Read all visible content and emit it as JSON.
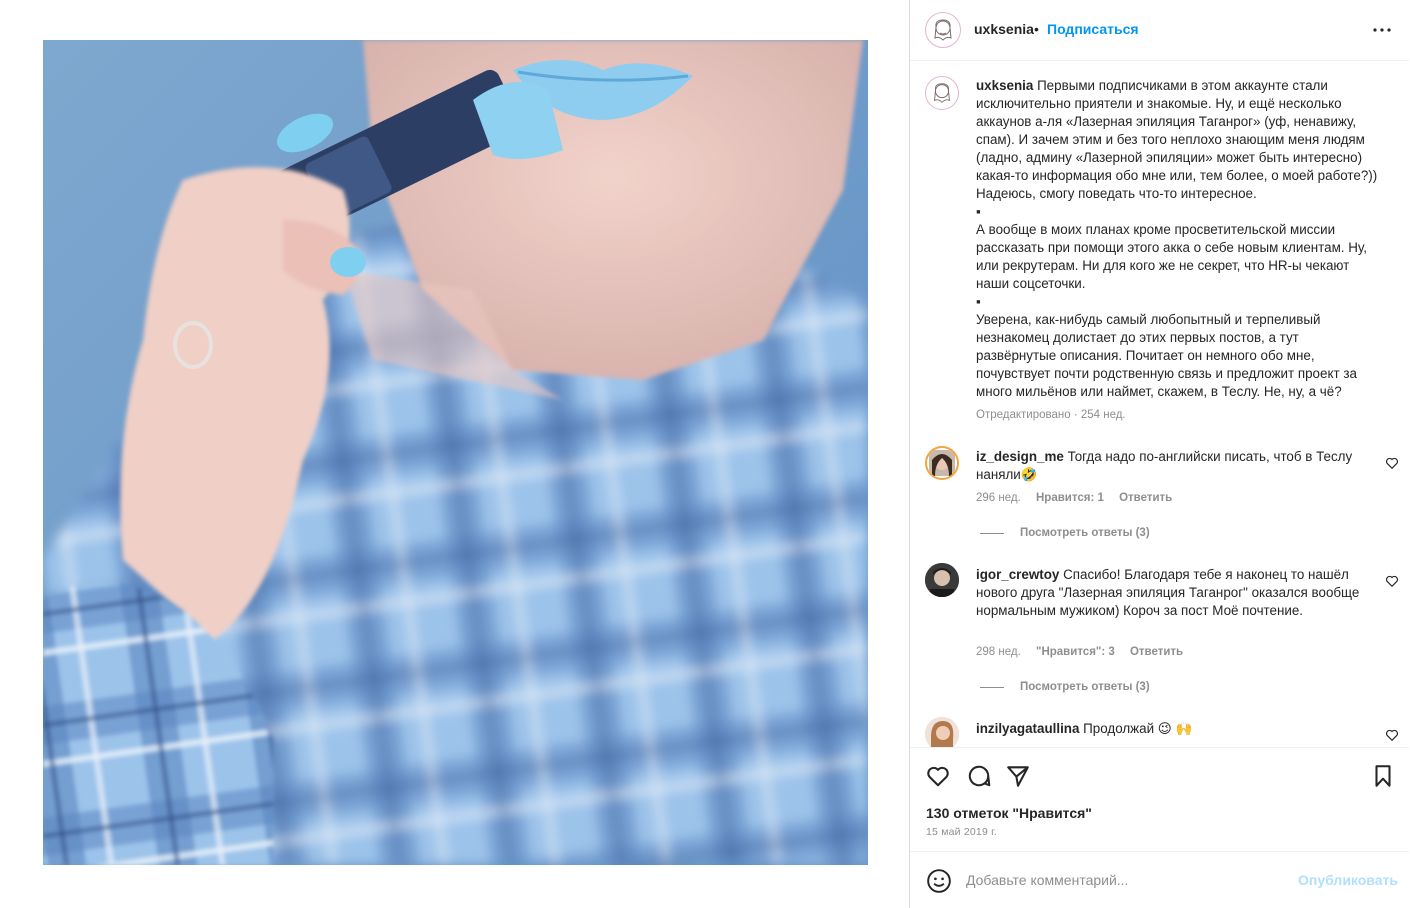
{
  "header": {
    "username": "uxksenia",
    "separator": "•",
    "follow_label": "Подписаться"
  },
  "caption": {
    "username": "uxksenia",
    "paragraph1": "Первыми подписчиками в этом аккаунте стали исключительно приятели и знакомые. Ну, и ещё несколько аккаунов а-ля «Лазерная эпиляция Таганрог» (уф, ненавижу, спам). И зачем этим и без того неплохо знающим меня людям (ладно, админу «Лазерной эпиляции» может быть интересно) какая-то информация обо мне или, тем более, о моей работе?)) Надеюсь, смогу поведать что-то интересное.",
    "bullet1": "▪",
    "paragraph2": "А вообще в моих планах кроме просветительской миссии рассказать при помощи этого акка о себе новым клиентам. Ну, или рекрутерам. Ни для кого же не секрет, что HR-ы чекают наши соцсеточки.",
    "bullet2": "▪",
    "paragraph3": "Уверена, как-нибудь самый любопытный и терпеливый незнакомец долистает до этих первых постов, а тут развёрнутые описания. Почитает он немного обо мне, почувствует почти родственную связь и предложит проект за много мильёнов или наймет, скажем, в Теслу. Не, ну, а чё?",
    "meta": "Отредактировано · 254 нед."
  },
  "comments": [
    {
      "username": "iz_design_me",
      "text": "Тогда надо по-английски писать, чтоб в Теслу наняли🤣",
      "time": "296 нед.",
      "likes": "Нравится: 1",
      "reply": "Ответить",
      "view_replies": "Посмотреть ответы (3)"
    },
    {
      "username": "igor_crewtoy",
      "text": "Спасибо! Благодаря тебе я наконец то нашёл нового друга \"Лазерная эпиляция Таганрог\" оказался вообще нормальным мужиком) Короч за пост Моё почтение.",
      "time": "298 нед.",
      "likes": "\"Нравится\": 3",
      "reply": "Ответить",
      "view_replies": "Посмотреть ответы (3)"
    },
    {
      "username": "inzilyagataullina",
      "text": "Продолжай 😉 🙌"
    }
  ],
  "actions": {
    "likes_count": "130 отметок \"Нравится\"",
    "date": "15 май 2019 г."
  },
  "comment_box": {
    "placeholder": "Добавьте комментарий...",
    "publish_label": "Опубликовать"
  },
  "icons": {
    "header_more": "more-horizontal-icon",
    "like": "heart-icon",
    "comment": "comment-icon",
    "share": "send-icon",
    "save": "bookmark-icon",
    "emoji": "emoji-icon"
  },
  "colors": {
    "link_blue": "#0095f6",
    "publish_disabled": "#b2dffc",
    "muted": "#8e8e8e",
    "text": "#262626"
  }
}
